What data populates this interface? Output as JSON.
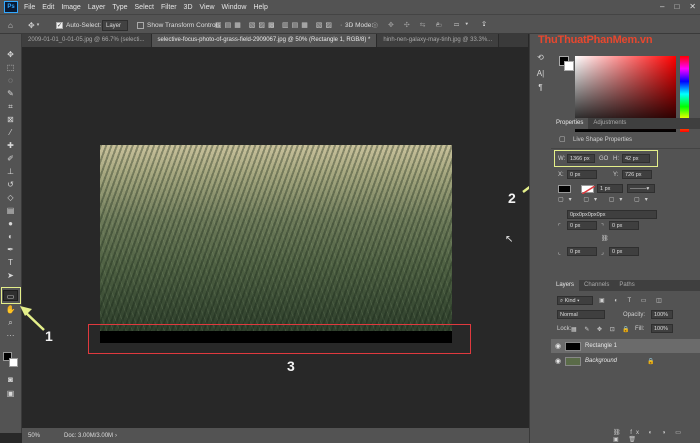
{
  "app": {
    "logo": "Ps",
    "menus": [
      "File",
      "Edit",
      "Image",
      "Layer",
      "Type",
      "Select",
      "Filter",
      "3D",
      "View",
      "Window",
      "Help"
    ],
    "window_controls": [
      "–",
      "□",
      "✕"
    ]
  },
  "options_bar": {
    "auto_select_label": "Auto-Select:",
    "auto_select_value": "Layer",
    "show_transform_label": "Show Transform Controls",
    "mode_3d_label": "3D Mode:"
  },
  "tabs": [
    {
      "label": "2009-01-01_0-01-05.jpg @ 66.7% (selecti...",
      "active": false
    },
    {
      "label": "selective-focus-photo-of-grass-field-2909067.jpg @ 50% (Rectangle 1, RGB/8) *",
      "active": true
    },
    {
      "label": "hinh-nen-galaxy-may-tinh.jpg @ 33.3%...",
      "active": false
    }
  ],
  "status": {
    "zoom": "50%",
    "doc": "Doc: 3.00M/3.00M"
  },
  "annotations": {
    "n1": "1",
    "n2": "2",
    "n3": "3"
  },
  "watermark": "ThuThuatPhanMem.vn",
  "properties": {
    "tab_properties": "Properties",
    "tab_adjustments": "Adjustments",
    "title": "Live Shape Properties",
    "w_label": "W:",
    "w_value": "1366 px",
    "go_label": "GO",
    "h_label": "H:",
    "h_value": "42 px",
    "x_label": "X:",
    "x_value": "0 px",
    "y_label": "Y:",
    "y_value": "726 px",
    "stroke_width": "1 px",
    "corner_text": "0px0px0px0px",
    "corner_tl": "0 px",
    "corner_tr": "0 px",
    "corner_bl": "0 px",
    "corner_br": "0 px"
  },
  "layers_panel": {
    "tab_layers": "Layers",
    "tab_channels": "Channels",
    "tab_paths": "Paths",
    "kind_label": "Kind",
    "blend_mode": "Normal",
    "opacity_label": "Opacity:",
    "opacity_value": "100%",
    "lock_label": "Lock:",
    "fill_label": "Fill:",
    "fill_value": "100%",
    "layers": [
      {
        "name": "Rectangle 1",
        "selected": true
      },
      {
        "name": "Background",
        "selected": false
      }
    ]
  },
  "colors": {
    "accent_yellow": "#e4ef8a",
    "highlight_red": "#e0393e"
  }
}
